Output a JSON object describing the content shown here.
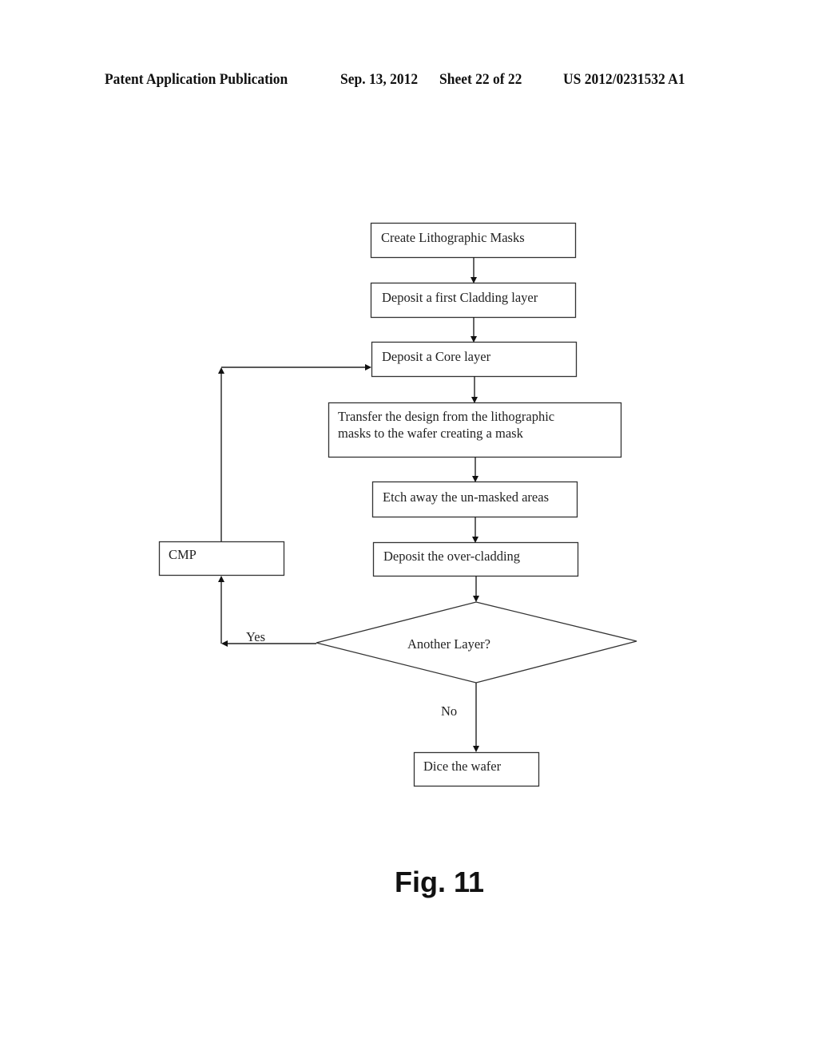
{
  "header": {
    "publication": "Patent Application Publication",
    "date": "Sep. 13, 2012",
    "sheet": "Sheet 22 of 22",
    "number": "US 2012/0231532 A1"
  },
  "flowchart": {
    "steps": [
      {
        "id": "create-masks",
        "label": "Create Lithographic Masks"
      },
      {
        "id": "deposit-cladding",
        "label": "Deposit a first Cladding layer"
      },
      {
        "id": "deposit-core",
        "label": "Deposit a Core layer"
      },
      {
        "id": "transfer-design",
        "label_line1": "Transfer the design from the lithographic",
        "label_line2": "masks to the wafer creating a mask"
      },
      {
        "id": "etch",
        "label": "Etch away the un-masked areas"
      },
      {
        "id": "over-cladding",
        "label": "Deposit the over-cladding"
      },
      {
        "id": "cmp",
        "label": "CMP"
      },
      {
        "id": "dice",
        "label": "Dice the wafer"
      }
    ],
    "decision": {
      "label": "Another Layer?",
      "yes_label": "Yes",
      "no_label": "No"
    }
  },
  "figure_label": "Fig. 11"
}
